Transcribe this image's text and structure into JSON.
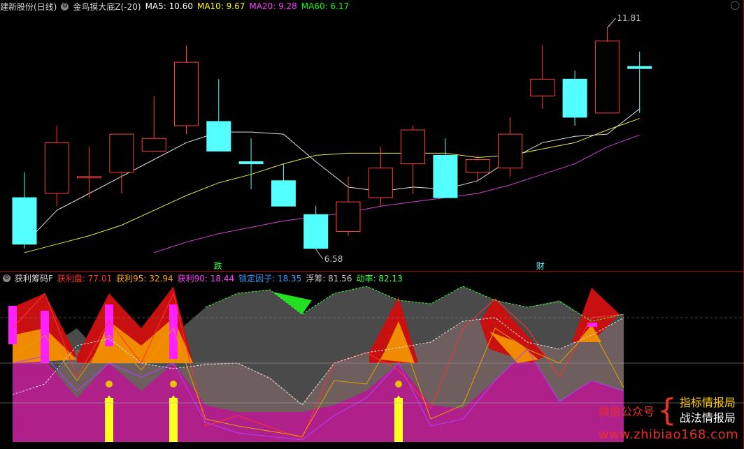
{
  "main_header": {
    "stock": "建新股份(日线)",
    "indicator": "金鸟摸大底Z(-20)",
    "items": [
      {
        "label": "MA5: 10.60",
        "color": "#ffffff"
      },
      {
        "label": "MA10: 9.67",
        "color": "#ffff00"
      },
      {
        "label": "MA20: 9.28",
        "color": "#ff40ff"
      },
      {
        "label": "MA60: 6.17",
        "color": "#00ff00"
      }
    ]
  },
  "sub_header": {
    "indicator": "获利筹码F",
    "items": [
      {
        "label": "获利盘: 77.01",
        "color": "#ff3030"
      },
      {
        "label": "获利95: 32.94",
        "color": "#ffa500"
      },
      {
        "label": "获利90: 18.44",
        "color": "#ff40ff"
      },
      {
        "label": "锁定因子: 18.35",
        "color": "#3399ff"
      },
      {
        "label": "浮筹: 81.56",
        "color": "#c0c0c0"
      },
      {
        "label": "动率: 82.13",
        "color": "#40ff40"
      }
    ]
  },
  "chart_data": {
    "type": "candlestick",
    "candles": [
      {
        "o": 7.8,
        "h": 8.4,
        "l": 6.6,
        "c": 6.7
      },
      {
        "o": 7.9,
        "h": 9.5,
        "l": 7.6,
        "c": 9.1
      },
      {
        "o": 8.3,
        "h": 9.0,
        "l": 7.8,
        "c": 8.3
      },
      {
        "o": 8.4,
        "h": 9.3,
        "l": 7.9,
        "c": 9.3
      },
      {
        "o": 8.9,
        "h": 10.2,
        "l": 8.9,
        "c": 9.2
      },
      {
        "o": 9.5,
        "h": 11.4,
        "l": 9.3,
        "c": 11.0
      },
      {
        "o": 9.6,
        "h": 10.6,
        "l": 8.9,
        "c": 8.9
      },
      {
        "o": 8.65,
        "h": 9.2,
        "l": 8.0,
        "c": 8.6
      },
      {
        "o": 8.2,
        "h": 8.6,
        "l": 7.6,
        "c": 7.6
      },
      {
        "o": 7.4,
        "h": 7.6,
        "l": 6.58,
        "c": 6.6
      },
      {
        "o": 7.0,
        "h": 8.3,
        "l": 6.9,
        "c": 7.7
      },
      {
        "o": 7.8,
        "h": 9.0,
        "l": 7.6,
        "c": 8.5
      },
      {
        "o": 8.6,
        "h": 9.5,
        "l": 7.9,
        "c": 9.4
      },
      {
        "o": 8.8,
        "h": 9.2,
        "l": 7.8,
        "c": 7.8
      },
      {
        "o": 8.4,
        "h": 8.8,
        "l": 8.2,
        "c": 8.7
      },
      {
        "o": 8.5,
        "h": 9.7,
        "l": 8.3,
        "c": 9.3
      },
      {
        "o": 10.2,
        "h": 11.4,
        "l": 9.9,
        "c": 10.6
      },
      {
        "o": 10.6,
        "h": 10.8,
        "l": 9.5,
        "c": 9.7
      },
      {
        "o": 9.8,
        "h": 11.81,
        "l": 9.8,
        "c": 11.5
      },
      {
        "o": 10.9,
        "h": 11.25,
        "l": 9.8,
        "c": 10.85
      }
    ],
    "ma5": [
      6.7,
      7.5,
      7.9,
      8.3,
      8.7,
      9.1,
      9.35,
      9.35,
      9.3,
      8.65,
      8.05,
      7.95,
      8.05,
      8.0,
      8.2,
      8.7,
      9.1,
      9.25,
      9.3,
      9.9
    ],
    "ma10": [
      6.5,
      6.7,
      6.9,
      7.15,
      7.5,
      7.85,
      8.15,
      8.35,
      8.6,
      8.8,
      8.85,
      8.85,
      8.85,
      8.85,
      8.75,
      8.8,
      8.95,
      9.1,
      9.4,
      9.67
    ],
    "ma20": [
      null,
      null,
      null,
      null,
      6.5,
      6.75,
      6.95,
      7.1,
      7.25,
      7.35,
      7.45,
      7.6,
      7.7,
      7.8,
      7.9,
      8.1,
      8.35,
      8.6,
      9.0,
      9.28
    ],
    "price_labels": {
      "high": "11.81",
      "low": "6.58"
    },
    "markers": {
      "die": "跌",
      "cai": "财"
    }
  },
  "watermark": {
    "label": "微信公众号",
    "line1": "指标情报局",
    "line2": "战法情报局",
    "url": "www.zhibiao168.com"
  },
  "close_icon": "close-icon"
}
